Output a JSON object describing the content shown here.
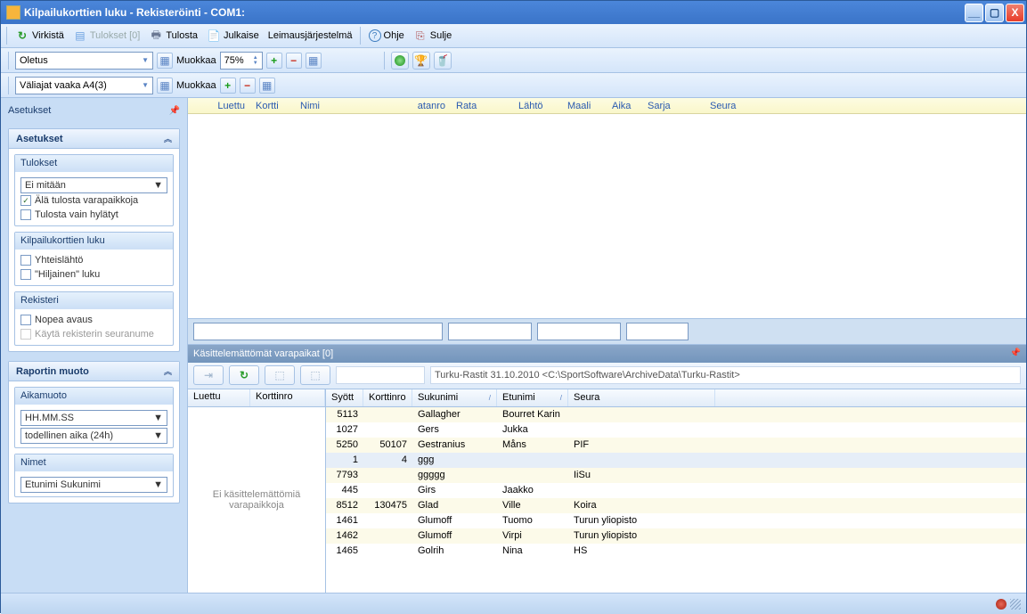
{
  "title": "Kilpailukorttien luku - Rekisteröinti - COM1:",
  "toolbar": {
    "refresh": "Virkistä",
    "results": "Tulokset [0]",
    "print": "Tulosta",
    "publish": "Julkaise",
    "punching": "Leimausjärjestelmä",
    "help": "Ohje",
    "close": "Sulje"
  },
  "toolbar2": {
    "combo1": "Oletus",
    "edit1": "Muokkaa",
    "zoom": "75%"
  },
  "toolbar3": {
    "combo2": "Väliajat vaaka A4(3)",
    "edit2": "Muokkaa"
  },
  "sidebar": {
    "header": "Asetukset",
    "panel1": "Asetukset",
    "g_results": "Tulokset",
    "results_combo": "Ei mitään",
    "cb_no_vacancy": "Älä tulosta varapaikkoja",
    "cb_only_dsq": "Tulosta vain hylätyt",
    "g_read": "Kilpailukorttien luku",
    "cb_massstart": "Yhteislähtö",
    "cb_silent": "\"Hiljainen\" luku",
    "g_reg": "Rekisteri",
    "cb_quickopen": "Nopea avaus",
    "cb_usereg": "Käytä rekisterin seuranume",
    "panel2": "Raportin muoto",
    "g_time": "Aikamuoto",
    "time_combo1": "HH.MM.SS",
    "time_combo2": "todellinen aika (24h)",
    "g_names": "Nimet",
    "names_combo": "Etunimi Sukunimi"
  },
  "upper_headers": [
    "Luettu",
    "Kortti",
    "Nimi",
    "atanro",
    "Rata",
    "Lähtö",
    "Maali",
    "Aika",
    "Sarja",
    "Seura"
  ],
  "section_title": "Käsittelemättömät varapaikat [0]",
  "archive_path": "Turku-Rastit  31.10.2010  <C:\\SportSoftware\\ArchiveData\\Turku-Rastit>",
  "left_grid": {
    "h1": "Luettu",
    "h2": "Korttinro",
    "msg": "Ei käsittelemättömiä varapaikkoja"
  },
  "right_grid": {
    "h_syott": "Syött",
    "h_kortti": "Korttinro",
    "h_suku": "Sukunimi",
    "h_etu": "Etunimi",
    "h_seura": "Seura",
    "rows": [
      {
        "syott": "5113",
        "kortti": "",
        "suku": "Gallagher",
        "etu": "Bourret Karin",
        "seura": ""
      },
      {
        "syott": "1027",
        "kortti": "",
        "suku": "Gers",
        "etu": "Jukka",
        "seura": ""
      },
      {
        "syott": "5250",
        "kortti": "50107",
        "suku": "Gestranius",
        "etu": "Måns",
        "seura": "PIF"
      },
      {
        "syott": "1",
        "kortti": "4",
        "suku": "ggg",
        "etu": "",
        "seura": "",
        "sel": true
      },
      {
        "syott": "7793",
        "kortti": "",
        "suku": "ggggg",
        "etu": "",
        "seura": "IiSu"
      },
      {
        "syott": "445",
        "kortti": "",
        "suku": "Girs",
        "etu": "Jaakko",
        "seura": ""
      },
      {
        "syott": "8512",
        "kortti": "130475",
        "suku": "Glad",
        "etu": "Ville",
        "seura": "Koira"
      },
      {
        "syott": "1461",
        "kortti": "",
        "suku": "Glumoff",
        "etu": "Tuomo",
        "seura": "Turun yliopisto"
      },
      {
        "syott": "1462",
        "kortti": "",
        "suku": "Glumoff",
        "etu": "Virpi",
        "seura": "Turun yliopisto"
      },
      {
        "syott": "1465",
        "kortti": "",
        "suku": "Golrih",
        "etu": "Nina",
        "seura": "HS"
      }
    ]
  }
}
